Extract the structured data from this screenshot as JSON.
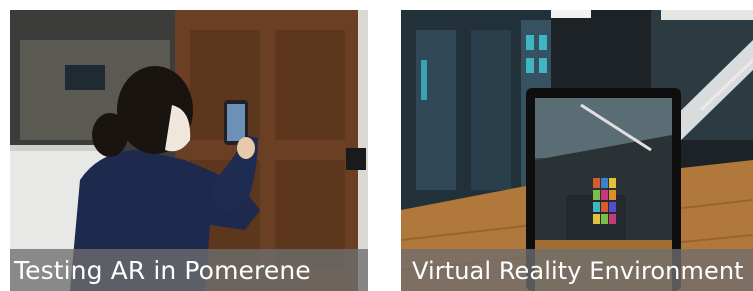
{
  "panels": [
    {
      "caption": "Testing AR in Pomerene",
      "scene": "person-holding-phone-ar"
    },
    {
      "caption": "Virtual Reality Environment",
      "scene": "vr-atrium-with-tablet"
    }
  ],
  "colors": {
    "caption_bar": "#6e6e6e",
    "caption_text": "#ffffff",
    "door_wood": "#6b3f24",
    "jacket": "#1d2a4e",
    "floor_wood": "#b0783a"
  }
}
